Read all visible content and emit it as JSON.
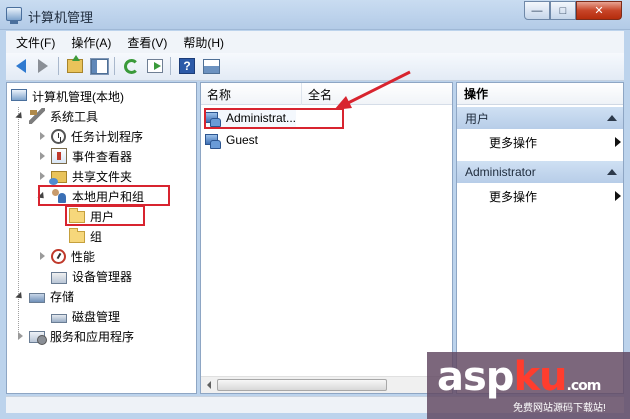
{
  "window": {
    "title": "计算机管理",
    "controls": {
      "minimize": "—",
      "maximize": "□",
      "close": "✕"
    }
  },
  "menu": [
    "文件(F)",
    "操作(A)",
    "查看(V)",
    "帮助(H)"
  ],
  "toolbar": [
    "back-icon",
    "forward-icon",
    "up-folder-icon",
    "show-hide-tree-icon",
    "refresh-icon",
    "export-list-icon",
    "help-icon",
    "view-icon"
  ],
  "tree": {
    "root": "计算机管理(本地)",
    "system_tools": "系统工具",
    "task_scheduler": "任务计划程序",
    "event_viewer": "事件查看器",
    "shared_folders": "共享文件夹",
    "local_users_groups": "本地用户和组",
    "users": "用户",
    "groups": "组",
    "performance": "性能",
    "device_manager": "设备管理器",
    "storage": "存储",
    "disk_management": "磁盘管理",
    "services_apps": "服务和应用程序"
  },
  "list": {
    "columns": [
      "名称",
      "全名"
    ],
    "rows": [
      {
        "name": "Administrat...",
        "fullname": ""
      },
      {
        "name": "Guest",
        "fullname": ""
      }
    ]
  },
  "actions": {
    "title": "操作",
    "sections": [
      {
        "header": "用户",
        "item": "更多操作"
      },
      {
        "header": "Administrator",
        "item": "更多操作"
      }
    ]
  },
  "annotation_color": "#d8242f",
  "watermark": {
    "logo_main": "asp",
    "logo_accent": "ku",
    "logo_suffix": ".com",
    "caption": "免费网站源码下载站!"
  }
}
